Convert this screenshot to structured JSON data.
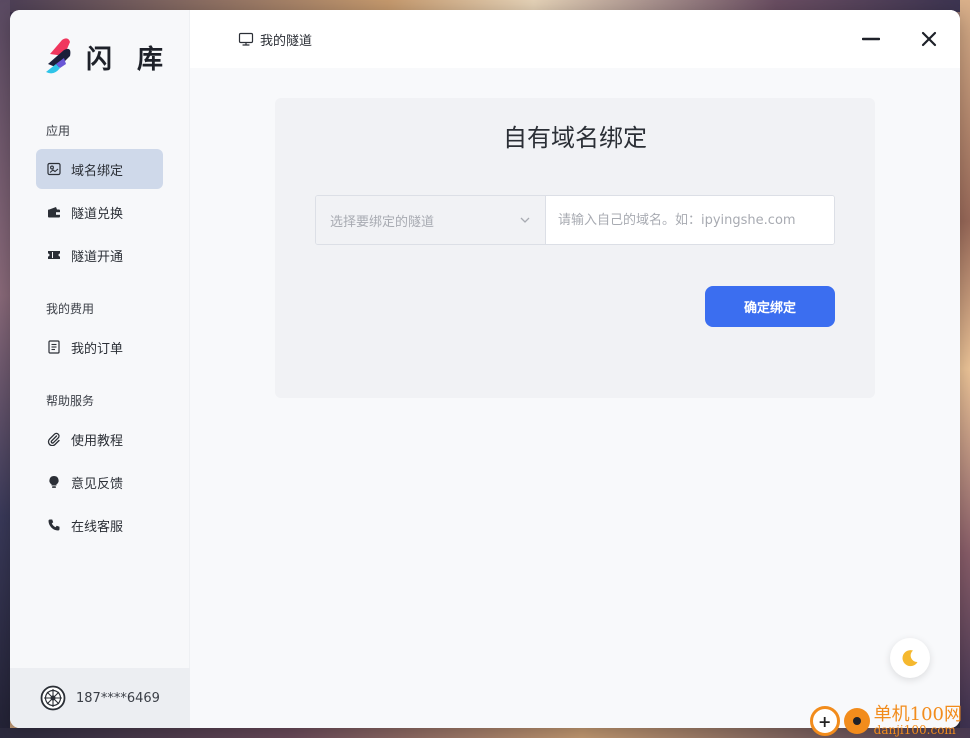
{
  "app": {
    "name": "闪 库"
  },
  "sidebar": {
    "sections": [
      {
        "title": "应用",
        "items": [
          {
            "label": "域名绑定",
            "icon": "domain-icon",
            "active": true
          },
          {
            "label": "隧道兑换",
            "icon": "wallet-icon",
            "active": false
          },
          {
            "label": "隧道开通",
            "icon": "ticket-icon",
            "active": false
          }
        ]
      },
      {
        "title": "我的费用",
        "items": [
          {
            "label": "我的订单",
            "icon": "order-icon",
            "active": false
          }
        ]
      },
      {
        "title": "帮助服务",
        "items": [
          {
            "label": "使用教程",
            "icon": "paperclip-icon",
            "active": false
          },
          {
            "label": "意见反馈",
            "icon": "bulb-icon",
            "active": false
          },
          {
            "label": "在线客服",
            "icon": "phone-icon",
            "active": false
          }
        ]
      }
    ],
    "user": {
      "phone": "187****6469"
    }
  },
  "titlebar": {
    "tab_label": "我的隧道"
  },
  "main": {
    "title": "自有域名绑定",
    "select_placeholder": "选择要绑定的隧道",
    "domain_placeholder": "请输入自己的域名。如：ipyingshe.com",
    "domain_value": "",
    "confirm_label": "确定绑定"
  },
  "watermark": {
    "cn": "单机100网",
    "en": "danji100.com"
  },
  "colors": {
    "accent": "#3b6ef0",
    "active_nav": "#cfd9ea",
    "theme_moon": "#f5b82e"
  }
}
